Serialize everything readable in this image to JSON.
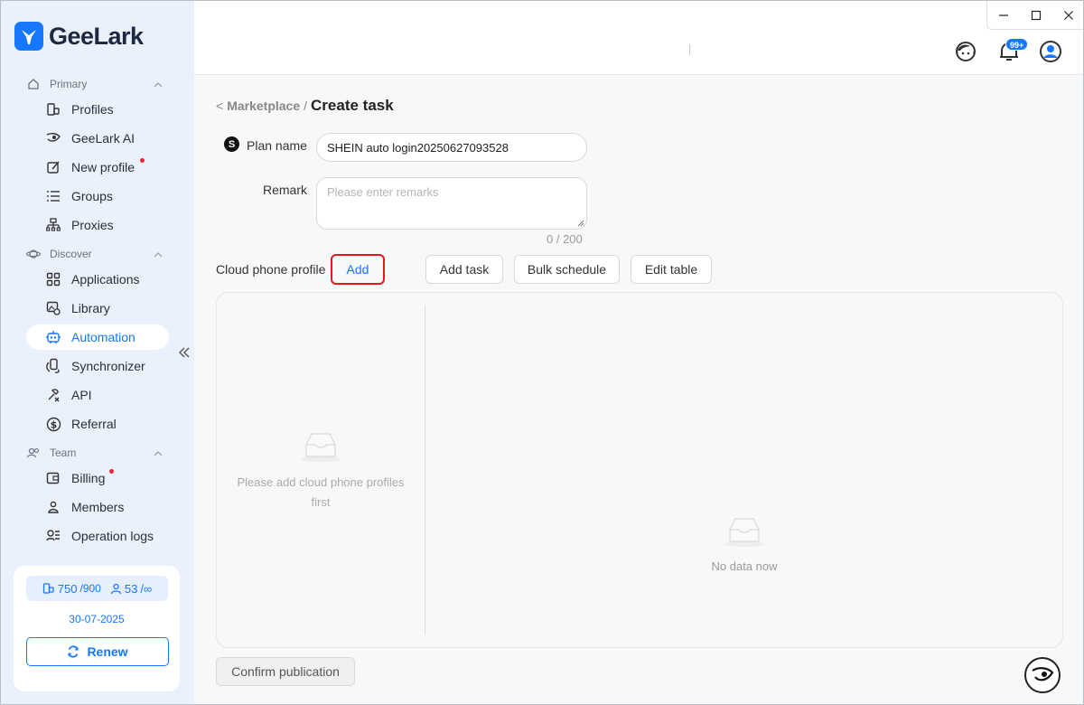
{
  "app": {
    "brand": "GeeLark",
    "accent_color": "#1677ff"
  },
  "sidebar": {
    "sections": [
      {
        "label": "Primary",
        "icon": "home-icon"
      },
      {
        "label": "Discover",
        "icon": "planet-icon"
      },
      {
        "label": "Team",
        "icon": "team-icon"
      }
    ],
    "items": [
      {
        "label": "Profiles",
        "icon": "profiles-icon"
      },
      {
        "label": "GeeLark AI",
        "icon": "ai-eye-icon"
      },
      {
        "label": "New profile",
        "icon": "edit-icon",
        "dot": true
      },
      {
        "label": "Groups",
        "icon": "list-icon"
      },
      {
        "label": "Proxies",
        "icon": "network-icon"
      },
      {
        "label": "Applications",
        "icon": "grid-icon"
      },
      {
        "label": "Library",
        "icon": "library-icon"
      },
      {
        "label": "Automation",
        "icon": "robot-icon",
        "active": true
      },
      {
        "label": "Synchronizer",
        "icon": "sync-icon"
      },
      {
        "label": "API",
        "icon": "api-icon"
      },
      {
        "label": "Referral",
        "icon": "dollar-icon"
      },
      {
        "label": "Billing",
        "icon": "wallet-icon",
        "dot": true
      },
      {
        "label": "Members",
        "icon": "user-icon"
      },
      {
        "label": "Operation logs",
        "icon": "logs-icon"
      }
    ],
    "quota": {
      "profiles_used": "750",
      "profiles_total": "/900",
      "members_used": "53",
      "members_total": "/∞",
      "date": "30-07-2025",
      "renew_label": "Renew"
    }
  },
  "topbar": {
    "notification_badge": "99+"
  },
  "breadcrumb": {
    "back": "<",
    "parent": "Marketplace",
    "separator": "/",
    "current": "Create task"
  },
  "form": {
    "plan_name_label": "Plan name",
    "plan_name_value": "SHEIN auto login20250627093528",
    "plan_icon_letter": "S",
    "remark_label": "Remark",
    "remark_placeholder": "Please enter remarks",
    "remark_counter": "0 / 200",
    "cloud_phone_label": "Cloud phone profile",
    "add_label": "Add"
  },
  "toolbar": {
    "add_task": "Add task",
    "bulk_schedule": "Bulk schedule",
    "edit_table": "Edit table"
  },
  "panel": {
    "left_empty": "Please add cloud phone profiles first",
    "right_empty": "No data now"
  },
  "footer": {
    "confirm_label": "Confirm publication"
  }
}
